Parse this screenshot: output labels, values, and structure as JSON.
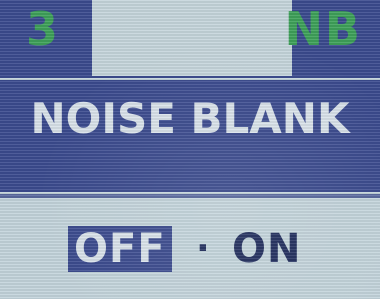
{
  "header": {
    "channel_number": "3",
    "mode_code": "NB"
  },
  "main": {
    "title": "NOISE BLANK"
  },
  "options": {
    "off_label": "OFF",
    "separator": "·",
    "on_label": "ON",
    "selected": "OFF"
  },
  "colors": {
    "lcd_background": "#c2d3da",
    "band_blue": "#3b4b8f",
    "status_green": "#3fa25a",
    "text_light": "#d9e2ea",
    "text_dark": "#1f2c5c"
  }
}
